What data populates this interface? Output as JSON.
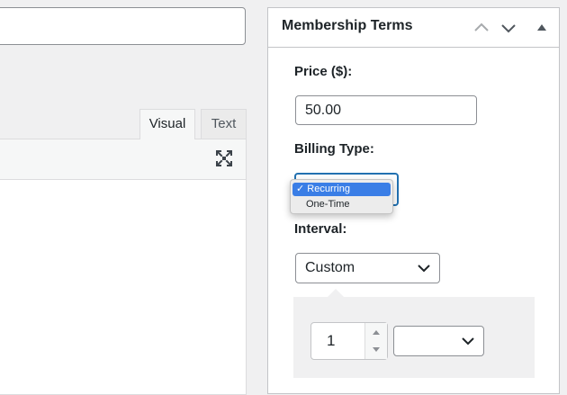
{
  "editor": {
    "tabs": [
      {
        "label": "Visual",
        "active": true
      },
      {
        "label": "Text",
        "active": false
      }
    ]
  },
  "metabox": {
    "title": "Membership Terms",
    "price_label": "Price ($):",
    "price_value": "50.00",
    "billing_type_label": "Billing Type:",
    "billing_options": [
      {
        "label": "✓ Recurring",
        "selected": true
      },
      {
        "label": "One-Time",
        "selected": false
      }
    ],
    "interval_label": "Interval:",
    "interval_value": "Custom",
    "custom_interval_count": "1",
    "custom_interval_unit": ""
  },
  "colors": {
    "accent": "#2271b1",
    "dropdown_highlight": "#3a7ee6"
  }
}
